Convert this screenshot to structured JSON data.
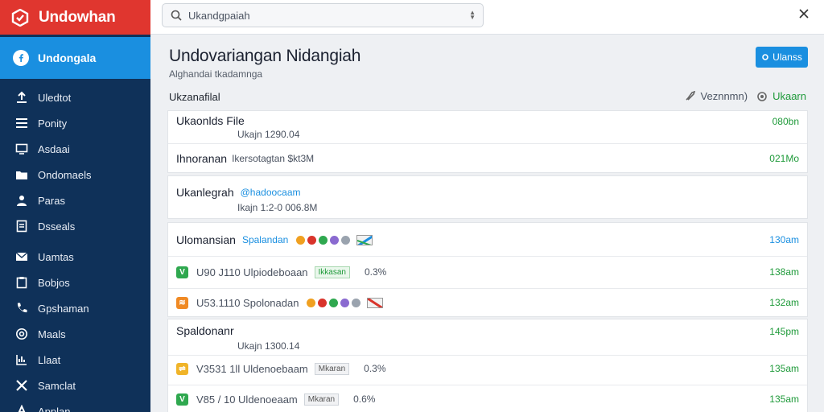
{
  "app": {
    "title": "Undowhan"
  },
  "sidebar": {
    "active": {
      "label": "Undongala"
    },
    "items": [
      {
        "label": "Uledtot",
        "icon": "upload-icon"
      },
      {
        "label": "Ponity",
        "icon": "list-icon"
      },
      {
        "label": "Asdaai",
        "icon": "monitor-icon"
      },
      {
        "label": "Ondomaels",
        "icon": "folder-icon"
      },
      {
        "label": "Paras",
        "icon": "person-icon"
      },
      {
        "label": "Dsseals",
        "icon": "document-icon"
      },
      {
        "label": "Uamtas",
        "icon": "mail-icon"
      },
      {
        "label": "Bobjos",
        "icon": "clipboard-icon"
      },
      {
        "label": "Gpshaman",
        "icon": "phone-icon"
      },
      {
        "label": "Maals",
        "icon": "at-icon"
      },
      {
        "label": "Llaat",
        "icon": "chart-icon"
      },
      {
        "label": "Samclat",
        "icon": "tools-icon"
      },
      {
        "label": "Applan",
        "icon": "apps-icon"
      }
    ]
  },
  "search": {
    "value": "Ukandgpaiah"
  },
  "header": {
    "title": "Undovariangan Nidangiah",
    "subtitle": "Alghandai tkadamnga",
    "button_label": "Ulanss"
  },
  "section": {
    "label": "Ukzanafilal",
    "tool1": "Veznnmn)",
    "tool2": "Ukaarn"
  },
  "file_card": {
    "title": "Ukaonlds File",
    "meta": "Ukajn 1290.04",
    "size1": "080bn",
    "row2_title": "Ihnoranan",
    "row2_meta": "Ikersotagtan $kt3M",
    "size2": "021Mo"
  },
  "card2": {
    "title": "Ukanlegrah",
    "link": "@hadoocaam",
    "meta": "Ikajn 1:2-0 006.8M"
  },
  "card3": {
    "title": "Ulomansian",
    "link": "Spalandan",
    "size": "130am",
    "rows": [
      {
        "check_color": "#2fa84f",
        "check": "V",
        "name": "U90 J110 Ulpiodeboaan",
        "chip": "Ikkasan",
        "pct": "0.3%",
        "size": "138am"
      },
      {
        "check_color": "#f08a24",
        "check": "≋",
        "name": "U53.1110 Spolonadan",
        "size": "132am"
      }
    ]
  },
  "card4": {
    "title": "Spaldonanr",
    "meta": "Ukajn 1300.14",
    "size": "145pm",
    "rows": [
      {
        "check_color": "#f0b429",
        "check": "⇌",
        "name": "V3531 1ll Uldenoebaam",
        "chip": "Mkaran",
        "pct": "0.3%",
        "size": "135am"
      },
      {
        "check_color": "#2fa84f",
        "check": "V",
        "name": "V85 / 10 Uldenoeaam",
        "chip": "Mkaran",
        "pct": "0.6%",
        "size": "135am"
      }
    ]
  },
  "colors": {
    "brand": "#e0362f",
    "sidebar": "#0f3159",
    "accent": "#1a8fe0",
    "success": "#1f9a3a"
  }
}
